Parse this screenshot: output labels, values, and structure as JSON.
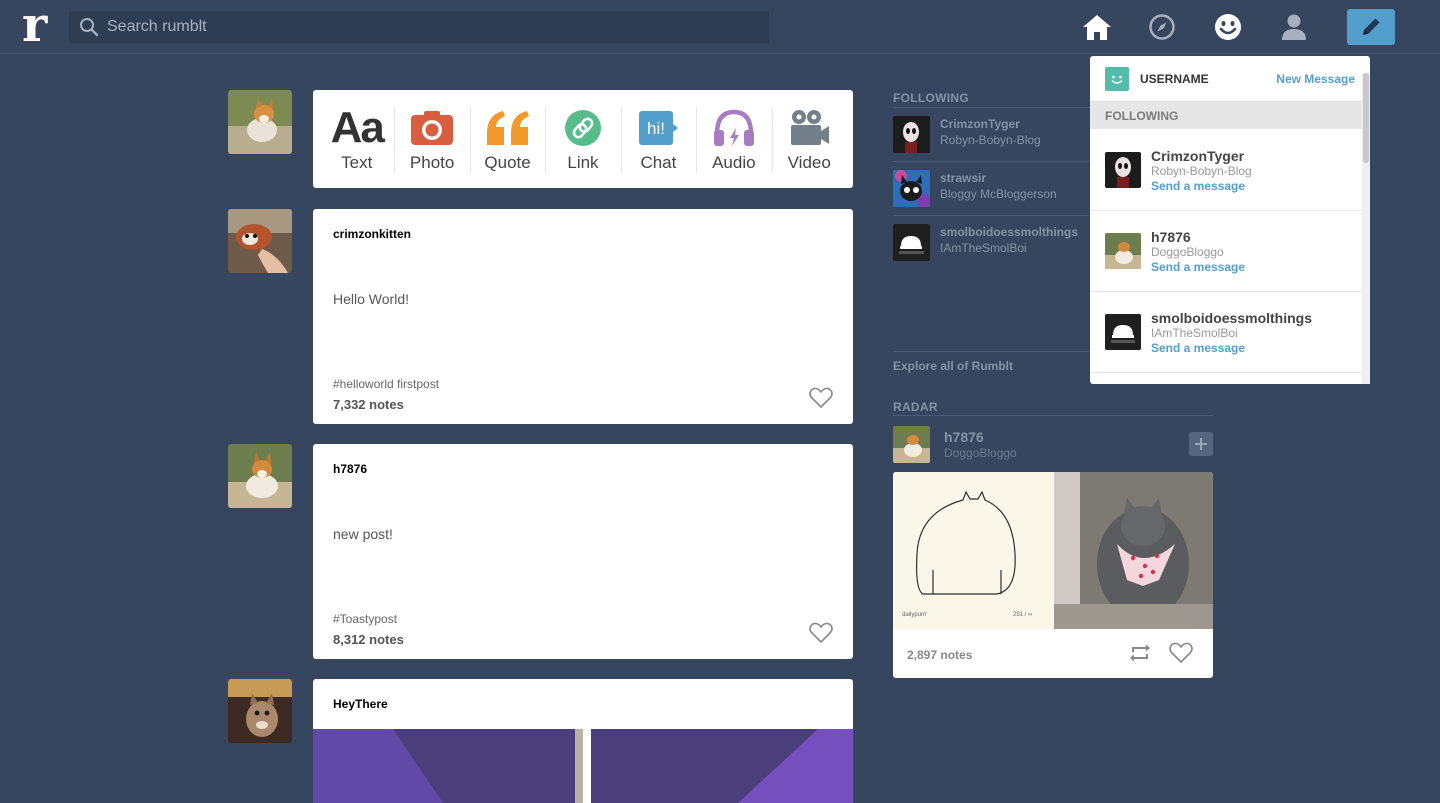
{
  "header": {
    "logo_letter": "r",
    "search_placeholder": "Search rumblt"
  },
  "post_types": [
    {
      "label": "Text",
      "icon": "text-aa-icon",
      "color": "#333333"
    },
    {
      "label": "Photo",
      "icon": "camera-icon",
      "color": "#d95e40"
    },
    {
      "label": "Quote",
      "icon": "quote-icon",
      "color": "#f2992e"
    },
    {
      "label": "Link",
      "icon": "link-icon",
      "color": "#56bc8a"
    },
    {
      "label": "Chat",
      "icon": "chat-icon",
      "color": "#529ecc"
    },
    {
      "label": "Audio",
      "icon": "headphones-icon",
      "color": "#a77dc2"
    },
    {
      "label": "Video",
      "icon": "video-camera-icon",
      "color": "#748089"
    }
  ],
  "posts": [
    {
      "username": "crimzonkitten",
      "body": "Hello World!",
      "tags": "#helloworld firstpost",
      "notes": "7,332 notes"
    },
    {
      "username": "h7876",
      "body": "new post!",
      "tags": "#Toastypost",
      "notes": "8,312 notes"
    },
    {
      "username": "HeyThere"
    }
  ],
  "sidebar": {
    "following_title": "FOLLOWING",
    "following": [
      {
        "name": "CrimzonTyger",
        "blog": "Robyn-Bobyn-Blog"
      },
      {
        "name": "strawsir",
        "blog": "Bloggy McBloggerson"
      },
      {
        "name": "smolboidoessmolthings",
        "blog": "IAmTheSmolBoi"
      }
    ],
    "explore": "Explore all of Rumblt",
    "radar_title": "RADAR",
    "radar": {
      "name": "h7876",
      "blog": "DoggoBloggo",
      "notes": "2,897 notes",
      "image_caption_left": "dailypurrr",
      "image_caption_right": "251 / ∞"
    }
  },
  "dropdown": {
    "username": "USERNAME",
    "new_message": "New Message",
    "section": "FOLLOWING",
    "items": [
      {
        "name": "CrimzonTyger",
        "blog": "Robyn-Bobyn-Blog",
        "action": "Send a message"
      },
      {
        "name": "h7876",
        "blog": "DoggoBloggo",
        "action": "Send a message"
      },
      {
        "name": "smolboidoessmolthings",
        "blog": "IAmTheSmolBoi",
        "action": "Send a message"
      }
    ]
  },
  "colors": {
    "background": "#37465f",
    "accent": "#529ecc",
    "muted_text": "#8593a8"
  }
}
